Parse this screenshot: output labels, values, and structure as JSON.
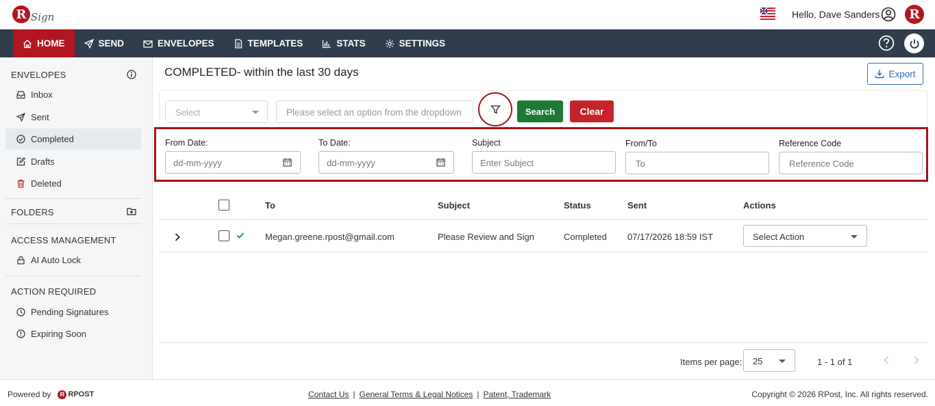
{
  "header": {
    "brand_letter": "R",
    "brand_text": "Sign",
    "greeting": "Hello, Dave Sanders",
    "avatar_letter": "R"
  },
  "nav": {
    "items": [
      {
        "label": "HOME",
        "icon": "home-icon",
        "active": true
      },
      {
        "label": "SEND",
        "icon": "send-icon"
      },
      {
        "label": "ENVELOPES",
        "icon": "envelope-icon"
      },
      {
        "label": "TEMPLATES",
        "icon": "document-icon"
      },
      {
        "label": "STATS",
        "icon": "chart-icon"
      },
      {
        "label": "SETTINGS",
        "icon": "gear-icon"
      }
    ]
  },
  "sidebar": {
    "envelopes_title": "ENVELOPES",
    "items": [
      {
        "label": "Inbox"
      },
      {
        "label": "Sent"
      },
      {
        "label": "Completed",
        "active": true
      },
      {
        "label": "Drafts"
      },
      {
        "label": "Deleted"
      }
    ],
    "folders_title": "FOLDERS",
    "access_title": "ACCESS MANAGEMENT",
    "access_item": "AI Auto Lock",
    "action_title": "ACTION REQUIRED",
    "action_items": [
      {
        "label": "Pending Signatures"
      },
      {
        "label": "Expiring Soon"
      }
    ]
  },
  "main": {
    "title": "COMPLETED- within the last 30 days",
    "export_label": "Export",
    "filter": {
      "select_placeholder": "Select",
      "dropdown_placeholder": "Please select an option from the dropdown",
      "search_label": "Search",
      "clear_label": "Clear"
    },
    "advanced": {
      "from_date_label": "From Date:",
      "from_date_placeholder": "dd-mm-yyyy",
      "to_date_label": "To Date:",
      "to_date_placeholder": "dd-mm-yyyy",
      "subject_label": "Subject",
      "subject_placeholder": "Enter Subject",
      "fromto_label": "From/To",
      "fromto_placeholder": "To",
      "refcode_label": "Reference Code",
      "refcode_placeholder": "Reference Code"
    },
    "table": {
      "headers": {
        "to": "To",
        "subject": "Subject",
        "status": "Status",
        "sent": "Sent",
        "actions": "Actions"
      },
      "rows": [
        {
          "to": "Megan.greene.rpost@gmail.com",
          "subject": "Please Review and Sign",
          "status": "Completed",
          "sent": "07/17/2026 18:59 IST",
          "action": "Select Action"
        }
      ]
    },
    "pagination": {
      "items_per_page_label": "Items per page:",
      "items_per_page": "25",
      "range": "1 - 1 of 1"
    }
  },
  "footer": {
    "powered_by": "Powered by",
    "rpost": "RPOST",
    "links": [
      "Contact Us",
      "General Terms & Legal Notices",
      "Patent, Trademark"
    ],
    "separator": "|",
    "copyright": "Copyright © 2026 RPost, Inc. All rights reserved."
  },
  "colors": {
    "brand_red": "#b3161f",
    "nav_bg": "#2f3d4c",
    "search_green": "#1c7a35",
    "clear_red": "#c5232b",
    "export_blue": "#2f6db5"
  }
}
